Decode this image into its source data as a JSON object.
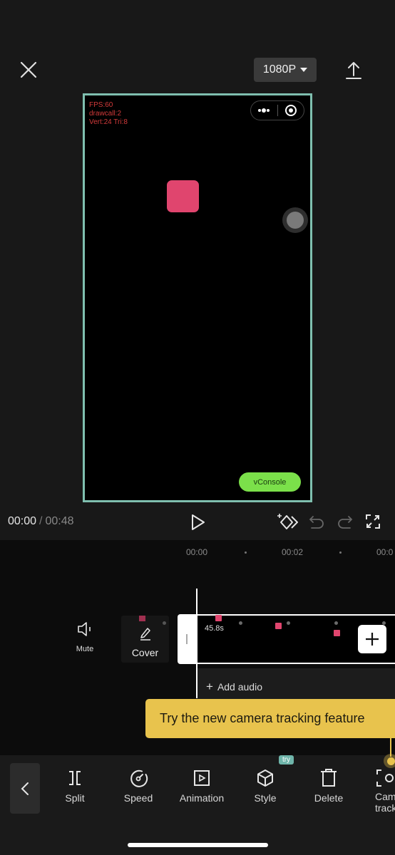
{
  "header": {
    "close_icon": "close-icon",
    "resolution_label": "1080P",
    "export_icon": "upload-icon"
  },
  "preview": {
    "stats": [
      "FPS:60",
      "drawcall:2",
      "Vert:24 Tri:8"
    ],
    "capsule_icons": [
      "more-icon",
      "target-icon"
    ],
    "vconsole_label": "vConsole",
    "colors": {
      "border": "#7fbfaf",
      "square": "#e0456e",
      "vconsole": "#7be04a",
      "stats": "#d23a3a"
    }
  },
  "playback": {
    "current_time": "00:00",
    "separator": "/",
    "total_time": "00:48",
    "icons": [
      "play-icon",
      "keyframe-icon",
      "undo-icon",
      "redo-icon",
      "fullscreen-icon"
    ]
  },
  "timeline": {
    "ticks": [
      "00:00",
      "00:02",
      "00:0"
    ],
    "mute_label": "Mute",
    "cover_label": "Cover",
    "clip_duration": "45.8s",
    "add_audio_label": "Add audio"
  },
  "tooltip": {
    "text": "Try the new camera tracking feature",
    "color": "#e8c34d"
  },
  "toolbar": {
    "items": [
      {
        "label": "Split",
        "icon": "split-icon"
      },
      {
        "label": "Speed",
        "icon": "speed-icon"
      },
      {
        "label": "Animation",
        "icon": "animation-icon"
      },
      {
        "label": "Style",
        "icon": "style-icon",
        "badge": "try"
      },
      {
        "label": "Delete",
        "icon": "delete-icon"
      },
      {
        "label": "Cam\ntrack",
        "icon": "camera-tracking-icon"
      }
    ]
  }
}
